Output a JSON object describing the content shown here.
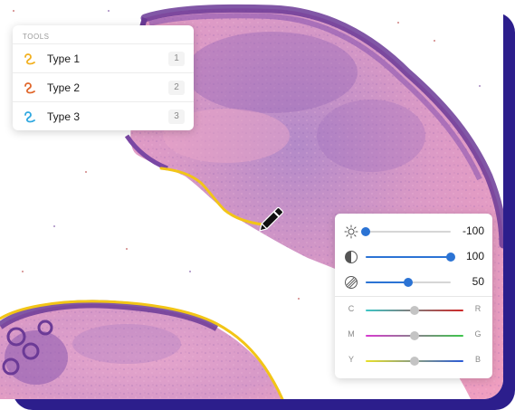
{
  "tools": {
    "title": "TOOLS",
    "items": [
      {
        "label": "Type 1",
        "key": "1",
        "icon": "squiggle-icon",
        "color": "#f2b01e"
      },
      {
        "label": "Type 2",
        "key": "2",
        "icon": "squiggle-icon",
        "color": "#e0662a"
      },
      {
        "label": "Type 3",
        "key": "3",
        "icon": "squiggle-icon",
        "color": "#2fa8e0"
      }
    ]
  },
  "adjustments": {
    "brightness": {
      "icon": "sun-icon",
      "value": "-100",
      "level": 0.0
    },
    "contrast": {
      "icon": "contrast-icon",
      "value": "100",
      "level": 1.0
    },
    "saturation": {
      "icon": "saturation-icon",
      "value": "50",
      "level": 0.5
    },
    "color_balance": [
      {
        "left": "C",
        "right": "R",
        "level": 0.5,
        "from": "#3cc6c6",
        "to": "#d02828"
      },
      {
        "left": "M",
        "right": "G",
        "level": 0.5,
        "from": "#d83ad0",
        "to": "#3cc64a"
      },
      {
        "left": "Y",
        "right": "B",
        "level": 0.5,
        "from": "#e8e02a",
        "to": "#2a5ad8"
      }
    ]
  },
  "colors": {
    "annotation": "#f2c517",
    "frame": "#2c1e8c",
    "accent": "#2b73d4"
  }
}
